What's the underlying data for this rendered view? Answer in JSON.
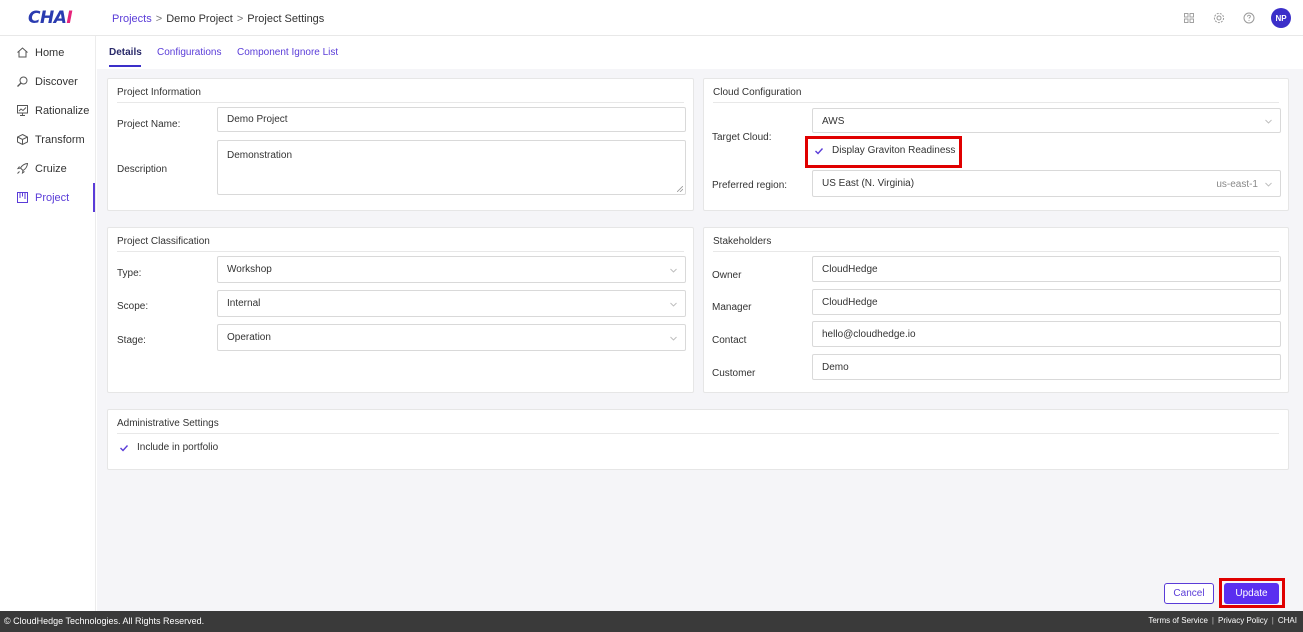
{
  "app": {
    "logo_main": "CHA",
    "logo_accent": "I",
    "colors": {
      "accent": "#5a3cd8",
      "primary_button": "#5a2ff0",
      "highlight": "#e00000",
      "footer_bg": "#3a3a3a"
    }
  },
  "breadcrumb": {
    "items": [
      "Projects",
      "Demo Project",
      "Project Settings"
    ],
    "separator": ">"
  },
  "header": {
    "icons": [
      "apps-grid-icon",
      "gear-icon",
      "help-icon"
    ],
    "avatar_initials": "NP"
  },
  "sidebar": {
    "items": [
      {
        "label": "Home",
        "icon": "home-icon"
      },
      {
        "label": "Discover",
        "icon": "discover-icon"
      },
      {
        "label": "Rationalize",
        "icon": "rationalize-icon"
      },
      {
        "label": "Transform",
        "icon": "transform-icon"
      },
      {
        "label": "Cruize",
        "icon": "rocket-icon"
      },
      {
        "label": "Project",
        "icon": "project-icon",
        "active": true
      }
    ]
  },
  "tabs": [
    {
      "label": "Details",
      "active": true
    },
    {
      "label": "Configurations"
    },
    {
      "label": "Component Ignore List"
    }
  ],
  "project_information": {
    "title": "Project Information",
    "name_label": "Project Name:",
    "name_value": "Demo Project",
    "description_label": "Description",
    "description_value": "Demonstration"
  },
  "cloud_configuration": {
    "title": "Cloud Configuration",
    "target_cloud_label": "Target Cloud:",
    "target_cloud_value": "AWS",
    "graviton_label": "Display Graviton Readiness",
    "graviton_checked": true,
    "region_label": "Preferred region:",
    "region_value": "US East (N. Virginia)",
    "region_code": "us-east-1"
  },
  "project_classification": {
    "title": "Project Classification",
    "type_label": "Type:",
    "type_value": "Workshop",
    "scope_label": "Scope:",
    "scope_value": "Internal",
    "stage_label": "Stage:",
    "stage_value": "Operation"
  },
  "stakeholders": {
    "title": "Stakeholders",
    "owner_label": "Owner",
    "owner_value": "CloudHedge",
    "manager_label": "Manager",
    "manager_value": "CloudHedge",
    "contact_label": "Contact",
    "contact_value": "hello@cloudhedge.io",
    "customer_label": "Customer",
    "customer_value": "Demo"
  },
  "administrative_settings": {
    "title": "Administrative Settings",
    "portfolio_label": "Include in portfolio",
    "portfolio_checked": true
  },
  "actions": {
    "cancel_label": "Cancel",
    "update_label": "Update"
  },
  "footer": {
    "copyright": "© CloudHedge Technologies. All Rights Reserved.",
    "links": [
      "Terms of Service",
      "Privacy Policy",
      "CHAI"
    ]
  }
}
